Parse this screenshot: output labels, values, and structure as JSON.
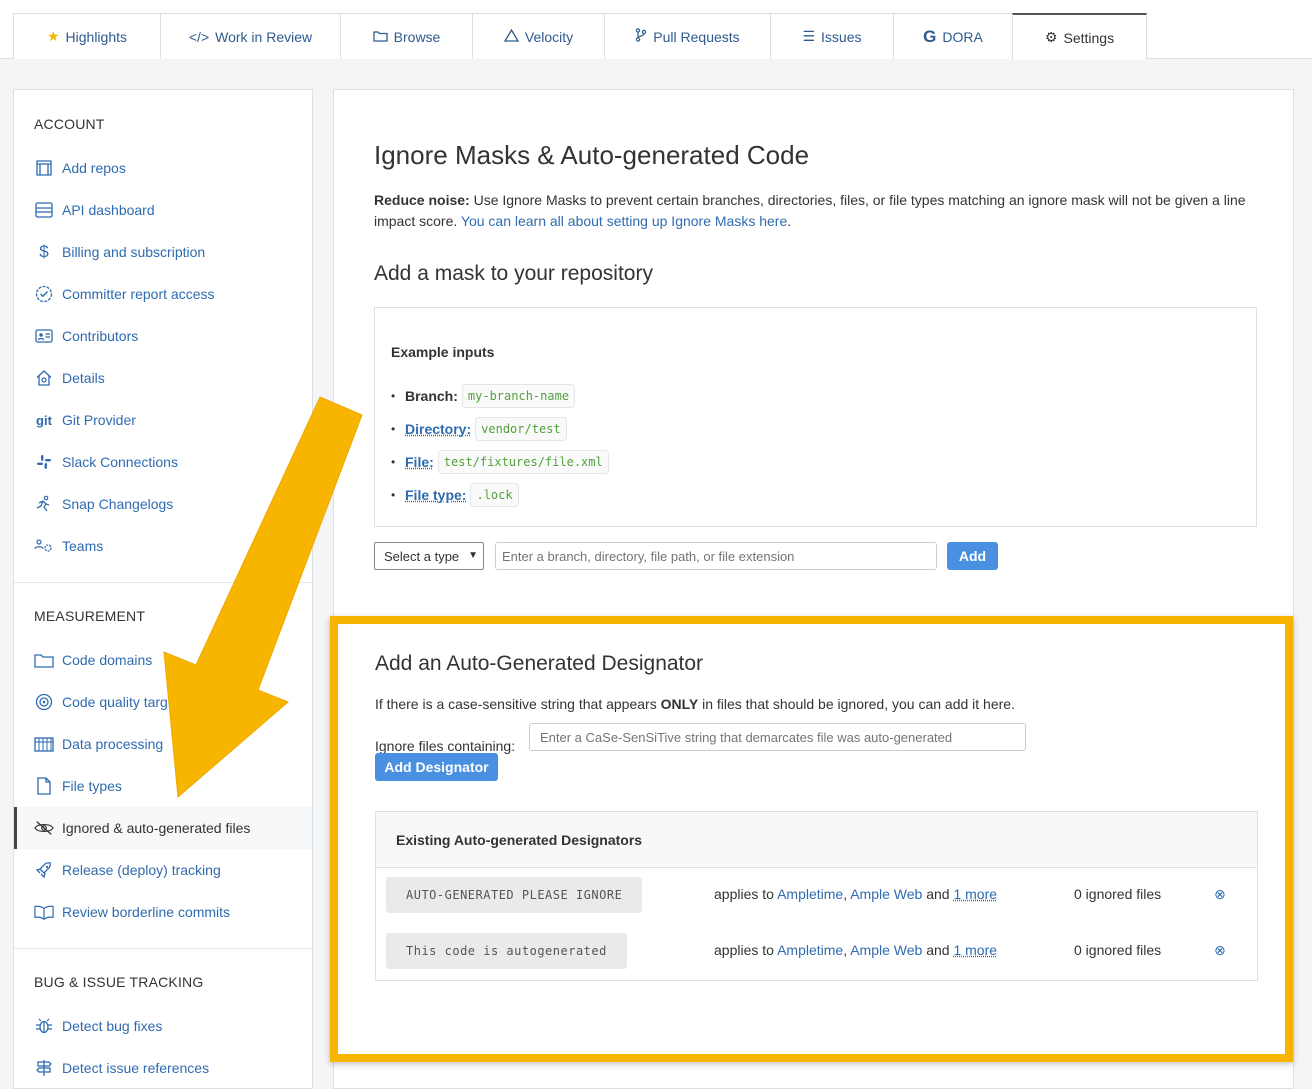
{
  "tabs": [
    {
      "label": "Highlights",
      "icon": "star-icon"
    },
    {
      "label": "Work in Review",
      "icon": "code-icon"
    },
    {
      "label": "Browse",
      "icon": "folder-icon"
    },
    {
      "label": "Velocity",
      "icon": "triangle-icon"
    },
    {
      "label": "Pull Requests",
      "icon": "git-branch-icon"
    },
    {
      "label": "Issues",
      "icon": "list-check-icon"
    },
    {
      "label": "DORA",
      "icon": "g-logo-icon"
    },
    {
      "label": "Settings",
      "icon": "gear-icon"
    }
  ],
  "sidebar": {
    "account_title": "ACCOUNT",
    "account_items": [
      {
        "label": "Add repos",
        "icon": "repo-icon"
      },
      {
        "label": "API dashboard",
        "icon": "server-icon"
      },
      {
        "label": "Billing and subscription",
        "icon": "dollar-icon"
      },
      {
        "label": "Committer report access",
        "icon": "badge-check-icon"
      },
      {
        "label": "Contributors",
        "icon": "id-card-icon"
      },
      {
        "label": "Details",
        "icon": "house-gear-icon"
      },
      {
        "label": "Git Provider",
        "icon": "git-icon"
      },
      {
        "label": "Slack Connections",
        "icon": "slack-icon"
      },
      {
        "label": "Snap Changelogs",
        "icon": "running-icon"
      },
      {
        "label": "Teams",
        "icon": "team-icon"
      }
    ],
    "measurement_title": "MEASUREMENT",
    "measurement_items": [
      {
        "label": "Code domains",
        "icon": "folder-icon"
      },
      {
        "label": "Code quality targe",
        "icon": "target-icon"
      },
      {
        "label": "Data processing",
        "icon": "calendar-grid-icon"
      },
      {
        "label": "File types",
        "icon": "file-icon"
      },
      {
        "label": "Ignored & auto-generated files",
        "icon": "eye-slash-icon"
      },
      {
        "label": "Release (deploy) tracking",
        "icon": "rocket-icon"
      },
      {
        "label": "Review borderline commits",
        "icon": "book-icon"
      }
    ],
    "bug_title": "BUG & ISSUE TRACKING",
    "bug_items": [
      {
        "label": "Detect bug fixes",
        "icon": "bug-icon"
      },
      {
        "label": "Detect issue references",
        "icon": "signpost-icon"
      }
    ]
  },
  "main": {
    "title": "Ignore Masks & Auto-generated Code",
    "intro_bold": "Reduce noise:",
    "intro_text": " Use Ignore Masks to prevent certain branches, directories, files, or file types matching an ignore mask will not be given a line impact score. ",
    "intro_link": "You can learn all about setting up Ignore Masks here",
    "intro_end": ".",
    "add_mask_title": "Add a mask to your repository",
    "examples_title": "Example inputs",
    "examples": [
      {
        "label": "Branch:",
        "value": "my-branch-name"
      },
      {
        "label": "Directory:",
        "value": "vendor/test"
      },
      {
        "label": "File:",
        "value": "test/fixtures/file.xml"
      },
      {
        "label": "File type:",
        "value": ".lock"
      }
    ],
    "select_label": "Select a type",
    "mask_placeholder": "Enter a branch, directory, file path, or file extension",
    "add_label": "Add"
  },
  "autogen": {
    "title": "Add an Auto-Generated Designator",
    "desc_pre": "If there is a case-sensitive string that appears ",
    "desc_bold": "ONLY",
    "desc_post": " in files that should be ignored, you can add it here.",
    "ignore_label": "Ignore files containing:",
    "ignore_placeholder": "Enter a CaSe-SenSiTive string that demarcates file was auto-generated",
    "add_designator_label": "Add Designator",
    "existing_title": "Existing Auto-generated Designators",
    "designators": [
      {
        "code": "AUTO-GENERATED PLEASE IGNORE",
        "applies_pre": "applies to ",
        "link1": "Ampletime",
        "sep": ", ",
        "link2": "Ample Web",
        "and": " and ",
        "more": "1 more",
        "ignored": "0 ignored files"
      },
      {
        "code": "This code is autogenerated",
        "applies_pre": "applies to ",
        "link1": "Ampletime",
        "sep": ", ",
        "link2": "Ample Web",
        "and": " and ",
        "more": "1 more",
        "ignored": "0 ignored files"
      }
    ]
  },
  "colors": {
    "accent": "#4a90e2",
    "link": "#2f6bb0",
    "highlight": "#f7b500"
  }
}
